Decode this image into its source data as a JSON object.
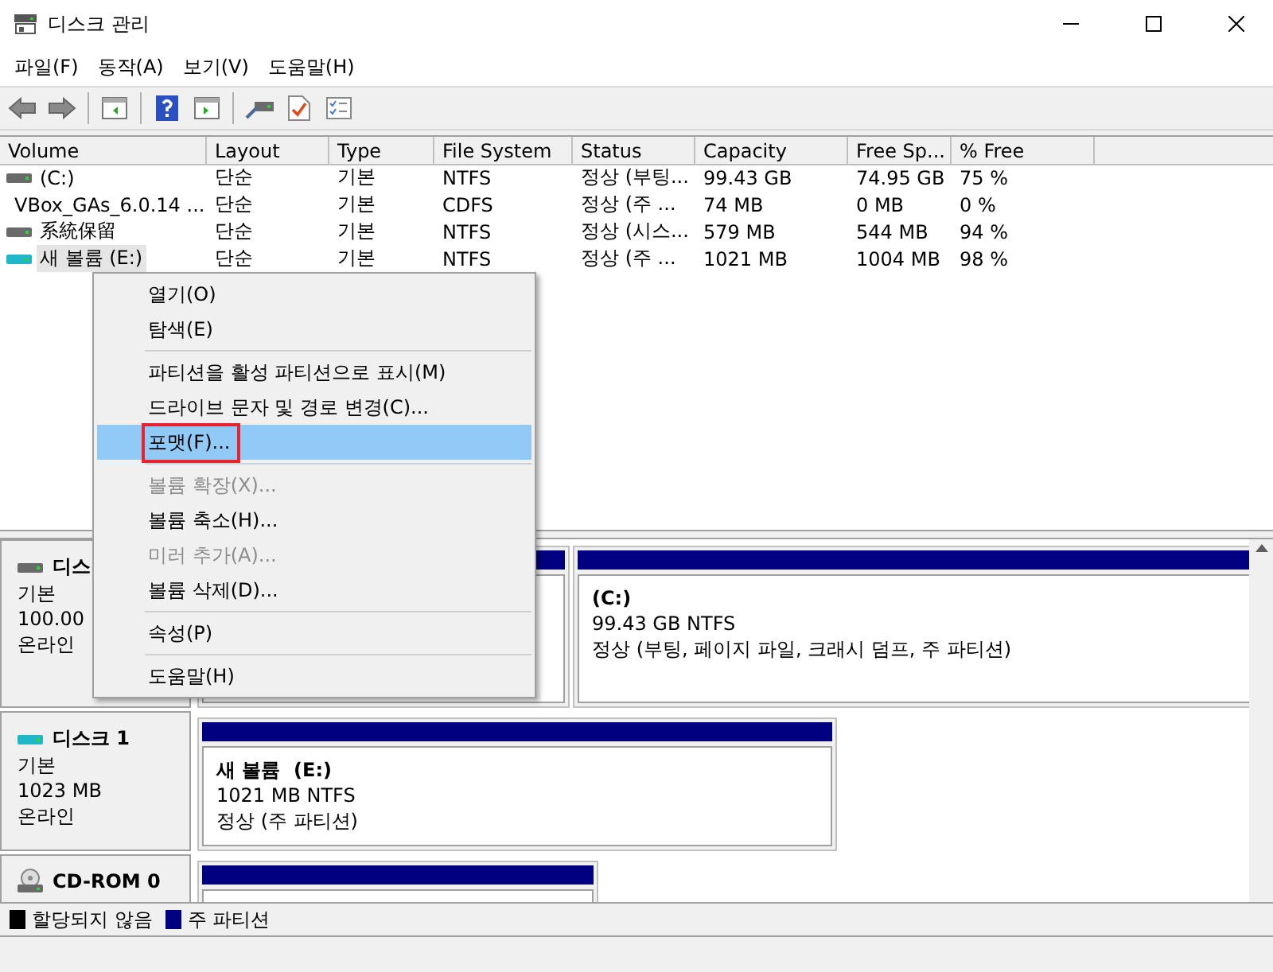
{
  "window": {
    "title": "디스크 관리"
  },
  "menu_bar": [
    "파일(F)",
    "동작(A)",
    "보기(V)",
    "도움말(H)"
  ],
  "toolbar": [
    {
      "kind": "back"
    },
    {
      "kind": "forward"
    },
    {
      "kind": "separator"
    },
    {
      "kind": "pane-left"
    },
    {
      "kind": "separator"
    },
    {
      "kind": "help"
    },
    {
      "kind": "pane-right"
    },
    {
      "kind": "separator"
    },
    {
      "kind": "drive"
    },
    {
      "kind": "check-doc"
    },
    {
      "kind": "checklist"
    }
  ],
  "table": {
    "columns": [
      "Volume",
      "Layout",
      "Type",
      "File System",
      "Status",
      "Capacity",
      "Free Sp...",
      "% Free"
    ],
    "rows": [
      {
        "kind": "fixed",
        "selected": false,
        "cells": [
          "(C:)",
          "단순",
          "기본",
          "NTFS",
          "정상 (부팅...",
          "99.43 GB",
          "74.95 GB",
          "75 %"
        ]
      },
      {
        "kind": "optical",
        "selected": false,
        "cells": [
          "VBox_GAs_6.0.14 ...",
          "단순",
          "기본",
          "CDFS",
          "정상 (주 ...",
          "74 MB",
          "0 MB",
          "0 %"
        ]
      },
      {
        "kind": "fixed",
        "selected": false,
        "cells": [
          "系統保留",
          "단순",
          "기본",
          "NTFS",
          "정상 (시스...",
          "579 MB",
          "544 MB",
          "94 %"
        ]
      },
      {
        "kind": "fixed",
        "selected": true,
        "cells": [
          "새 볼륨 (E:)",
          "단순",
          "기본",
          "NTFS",
          "정상 (주 ...",
          "1021 MB",
          "1004 MB",
          "98 %"
        ]
      }
    ]
  },
  "disks": [
    {
      "kind": "disk",
      "name": "디스",
      "lines": [
        "기본",
        "100.00",
        "온라인"
      ],
      "partitions": [
        {
          "kind": "covered"
        },
        {
          "kind": "primary",
          "name": "(C:)",
          "size": "99.43 GB NTFS",
          "status": "정상 (부팅, 페이지 파일, 크래시 덤프, 주 파티션)"
        }
      ]
    },
    {
      "kind": "removable",
      "name": "디스크 1",
      "lines": [
        "기본",
        "1023 MB",
        "온라인"
      ],
      "partitions": [
        {
          "kind": "primary",
          "name": "새 볼륨  (E:)",
          "size": "1021 MB NTFS",
          "status": "정상 (주 파티션)"
        }
      ]
    },
    {
      "kind": "cdrom",
      "name": "CD-ROM 0",
      "partitions": [
        {
          "kind": "cut"
        }
      ]
    }
  ],
  "legend": [
    {
      "label": "할당되지 않음",
      "color": "#000000"
    },
    {
      "label": "주 파티션",
      "color": "#000080"
    }
  ],
  "context_menu": [
    {
      "kind": "item",
      "label": "열기(O)",
      "disabled": false,
      "selected": false,
      "outlined": false
    },
    {
      "kind": "item",
      "label": "탐색(E)",
      "disabled": false,
      "selected": false,
      "outlined": false
    },
    {
      "kind": "separator"
    },
    {
      "kind": "item",
      "label": "파티션을 활성 파티션으로 표시(M)",
      "disabled": false,
      "selected": false,
      "outlined": false
    },
    {
      "kind": "item",
      "label": "드라이브 문자 및 경로 변경(C)...",
      "disabled": false,
      "selected": false,
      "outlined": false
    },
    {
      "kind": "item",
      "label": "포맷(F)...",
      "disabled": false,
      "selected": true,
      "outlined": true
    },
    {
      "kind": "separator"
    },
    {
      "kind": "item",
      "label": "볼륨 확장(X)...",
      "disabled": true,
      "selected": false,
      "outlined": false
    },
    {
      "kind": "item",
      "label": "볼륨 축소(H)...",
      "disabled": false,
      "selected": false,
      "outlined": false
    },
    {
      "kind": "item",
      "label": "미러 추가(A)...",
      "disabled": true,
      "selected": false,
      "outlined": false
    },
    {
      "kind": "item",
      "label": "볼륨 삭제(D)...",
      "disabled": false,
      "selected": false,
      "outlined": false
    },
    {
      "kind": "separator"
    },
    {
      "kind": "item",
      "label": "속성(P)",
      "disabled": false,
      "selected": false,
      "outlined": false
    },
    {
      "kind": "separator"
    },
    {
      "kind": "item",
      "label": "도움말(H)",
      "disabled": false,
      "selected": false,
      "outlined": false
    }
  ]
}
